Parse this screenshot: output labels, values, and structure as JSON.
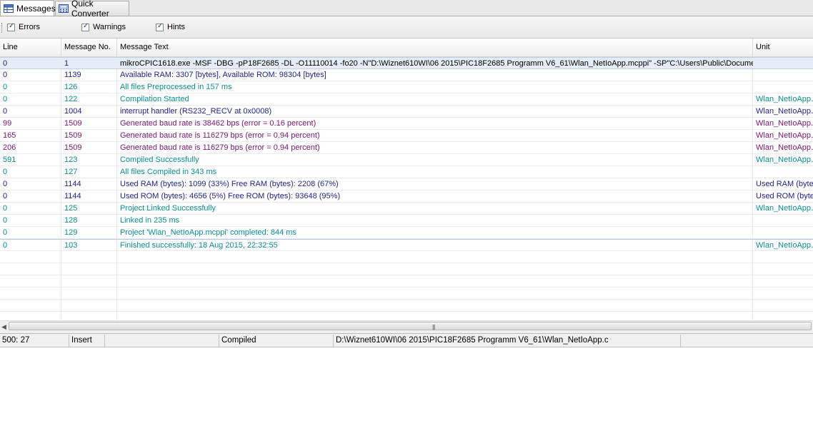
{
  "tabs": [
    {
      "label": "Messages",
      "icon": "grid-icon"
    },
    {
      "label": "Quick Converter",
      "icon": "calculator-icon"
    }
  ],
  "filters": [
    {
      "label": "Errors",
      "checked": true
    },
    {
      "label": "Warnings",
      "checked": true
    },
    {
      "label": "Hints",
      "checked": true
    }
  ],
  "columns": {
    "line": "Line",
    "msgno": "Message No.",
    "text": "Message Text",
    "unit": "Unit"
  },
  "rows": [
    {
      "line": "0",
      "no": "1",
      "text": "mikroCPIC1618.exe -MSF -DBG -pP18F2685 -DL -O11110014 -fo20 -N\"D:\\Wiznet610WI\\06 2015\\PIC18F2685 Programm V6_61\\Wlan_NetIoApp.mcppi\" -SP\"C:\\Users\\Public\\Docume...",
      "unit": "",
      "kind": "dark"
    },
    {
      "line": "0",
      "no": "1139",
      "text": "Available RAM: 3307 [bytes], Available ROM: 98304 [bytes]",
      "unit": "",
      "kind": "info"
    },
    {
      "line": "0",
      "no": "126",
      "text": "All files Preprocessed in 157 ms",
      "unit": "",
      "kind": "teal"
    },
    {
      "line": "0",
      "no": "122",
      "text": "Compilation Started",
      "unit": "Wlan_NetIoApp.",
      "kind": "teal"
    },
    {
      "line": "0",
      "no": "1004",
      "text": "interrupt handler (RS232_RECV at 0x0008)",
      "unit": "Wlan_NetIoApp.",
      "kind": "info"
    },
    {
      "line": "99",
      "no": "1509",
      "text": "Generated baud rate is 38462 bps (error = 0.16 percent)",
      "unit": "Wlan_NetIoApp.",
      "kind": "hint"
    },
    {
      "line": "165",
      "no": "1509",
      "text": "Generated baud rate is 116279 bps (error = 0.94 percent)",
      "unit": "Wlan_NetIoApp.",
      "kind": "hint"
    },
    {
      "line": "206",
      "no": "1509",
      "text": "Generated baud rate is 116279 bps (error = 0.94 percent)",
      "unit": "Wlan_NetIoApp.",
      "kind": "hint"
    },
    {
      "line": "591",
      "no": "123",
      "text": "Compiled Successfully",
      "unit": "Wlan_NetIoApp.",
      "kind": "teal"
    },
    {
      "line": "0",
      "no": "127",
      "text": "All files Compiled in 343 ms",
      "unit": "",
      "kind": "teal"
    },
    {
      "line": "0",
      "no": "1144",
      "text": "Used RAM (bytes): 1099 (33%)  Free RAM (bytes): 2208 (67%)",
      "unit": "Used RAM (bytes",
      "kind": "info"
    },
    {
      "line": "0",
      "no": "1144",
      "text": "Used ROM (bytes): 4656 (5%)  Free ROM (bytes): 93648 (95%)",
      "unit": "Used ROM (byte",
      "kind": "info"
    },
    {
      "line": "0",
      "no": "125",
      "text": "Project Linked Successfully",
      "unit": "Wlan_NetIoApp.",
      "kind": "teal"
    },
    {
      "line": "0",
      "no": "128",
      "text": "Linked in 235 ms",
      "unit": "",
      "kind": "teal"
    },
    {
      "line": "0",
      "no": "129",
      "text": "Project 'Wlan_NetIoApp.mcppi' completed: 844 ms",
      "unit": "",
      "kind": "teal"
    },
    {
      "line": "0",
      "no": "103",
      "text": "Finished successfully: 18 Aug 2015, 22:32:55",
      "unit": "Wlan_NetIoApp.",
      "kind": "teal"
    }
  ],
  "status": {
    "position": "500: 27",
    "mode": "Insert",
    "state": "Compiled",
    "file": "D:\\Wiznet610WI\\06 2015\\PIC18F2685 Programm V6_61\\Wlan_NetIoApp.c"
  },
  "colors": {
    "info": "#1f1f8f",
    "teal": "#0a8f8f",
    "hint": "#7a1670",
    "selected": "#e3ecf7"
  }
}
